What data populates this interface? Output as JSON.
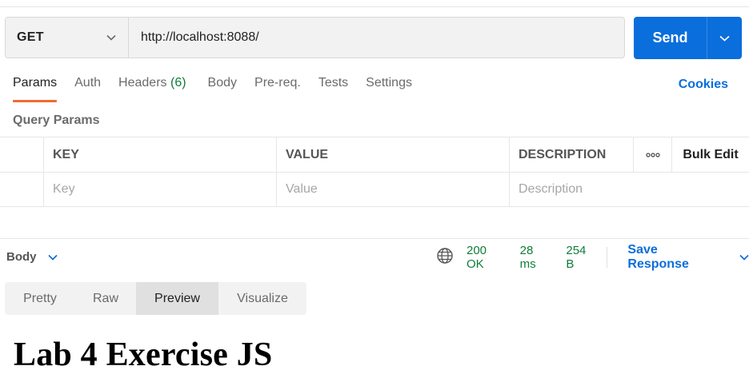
{
  "request": {
    "method": "GET",
    "url": "http://localhost:8088/",
    "send_label": "Send"
  },
  "tabs": {
    "params": "Params",
    "auth": "Auth",
    "headers": "Headers",
    "headers_count": "(6)",
    "body": "Body",
    "prereq": "Pre-req.",
    "tests": "Tests",
    "settings": "Settings",
    "cookies": "Cookies",
    "active": "Params"
  },
  "query_params": {
    "title": "Query Params",
    "columns": {
      "key": "KEY",
      "value": "VALUE",
      "description": "DESCRIPTION",
      "bulk_edit": "Bulk Edit"
    },
    "placeholders": {
      "key": "Key",
      "value": "Value",
      "description": "Description"
    }
  },
  "response": {
    "section_label": "Body",
    "status": "200 OK",
    "time": "28 ms",
    "size": "254 B",
    "save_label": "Save Response",
    "views": [
      "Pretty",
      "Raw",
      "Preview",
      "Visualize"
    ],
    "active_view": "Preview",
    "preview_heading": "Lab 4 Exercise JS"
  },
  "colors": {
    "accent_blue": "#0a6edc",
    "tab_underline": "#ef6c35",
    "status_green": "#0d7d3a"
  }
}
